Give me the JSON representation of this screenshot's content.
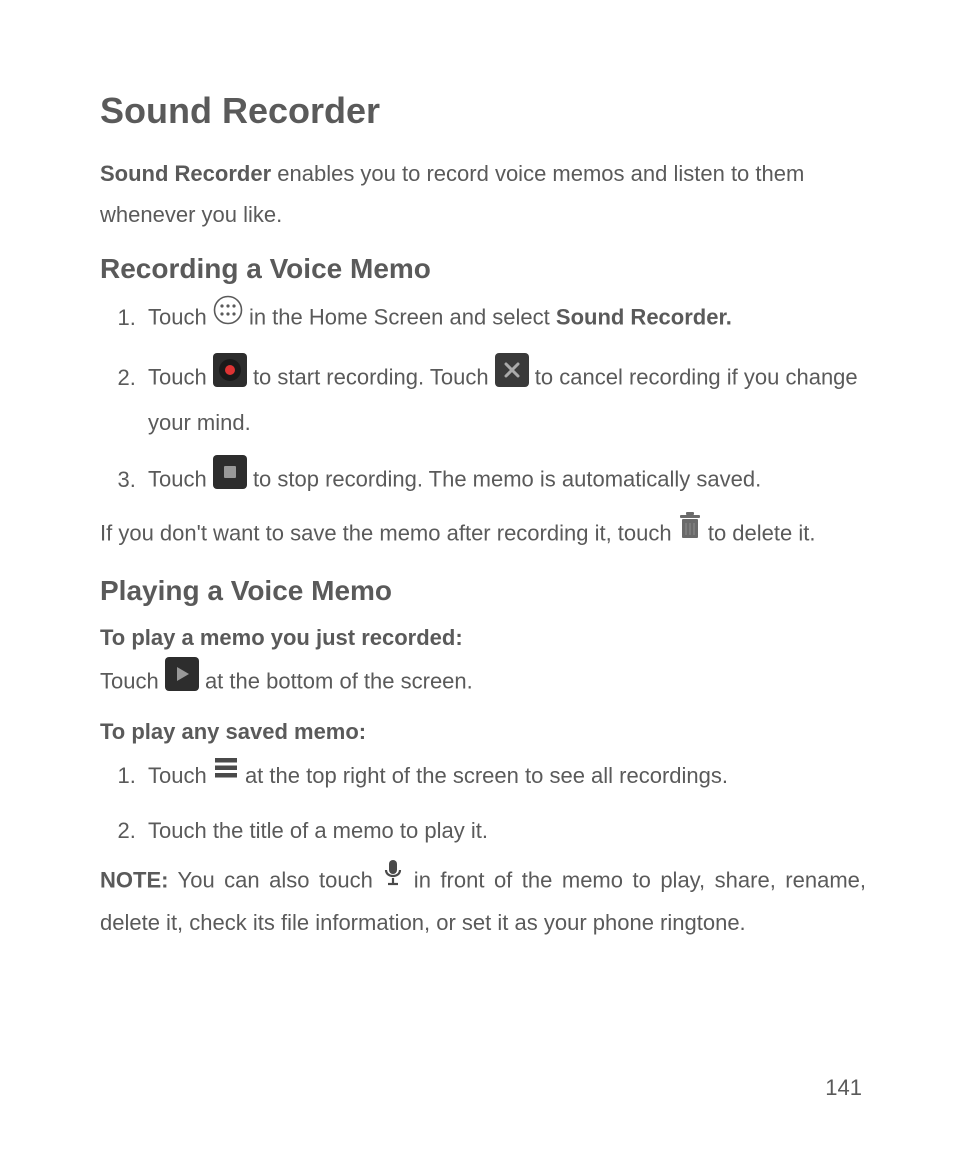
{
  "title": "Sound Recorder",
  "intro": {
    "bold": "Sound Recorder",
    "rest": " enables you to record voice memos and listen to them whenever you like."
  },
  "section1": {
    "heading": "Recording a Voice Memo",
    "item1a": "Touch ",
    "item1b": " in the Home Screen and select ",
    "item1c": "Sound Recorder.",
    "item2a": "Touch ",
    "item2b": " to start recording. Touch ",
    "item2c": " to cancel recording if you change your mind.",
    "item3a": "Touch ",
    "item3b": " to stop recording. The memo is automatically saved.",
    "para1a": "If you don't want to save the memo after recording it, touch ",
    "para1b": " to delete it."
  },
  "section2": {
    "heading": "Playing a Voice Memo",
    "sub1": "To play a memo you just recorded:",
    "p1a": "Touch ",
    "p1b": " at the bottom of the screen.",
    "sub2": "To play any saved memo:",
    "item1a": "Touch ",
    "item1b": " at the top right of the screen to see all recordings.",
    "item2": "Touch the title of a memo to play it.",
    "noteLabel": "NOTE:",
    "noteA": " You can also touch ",
    "noteB": " in front of the memo to play, share, rename, delete it, check its file information, or set it as your phone ringtone."
  },
  "pageNumber": "141"
}
